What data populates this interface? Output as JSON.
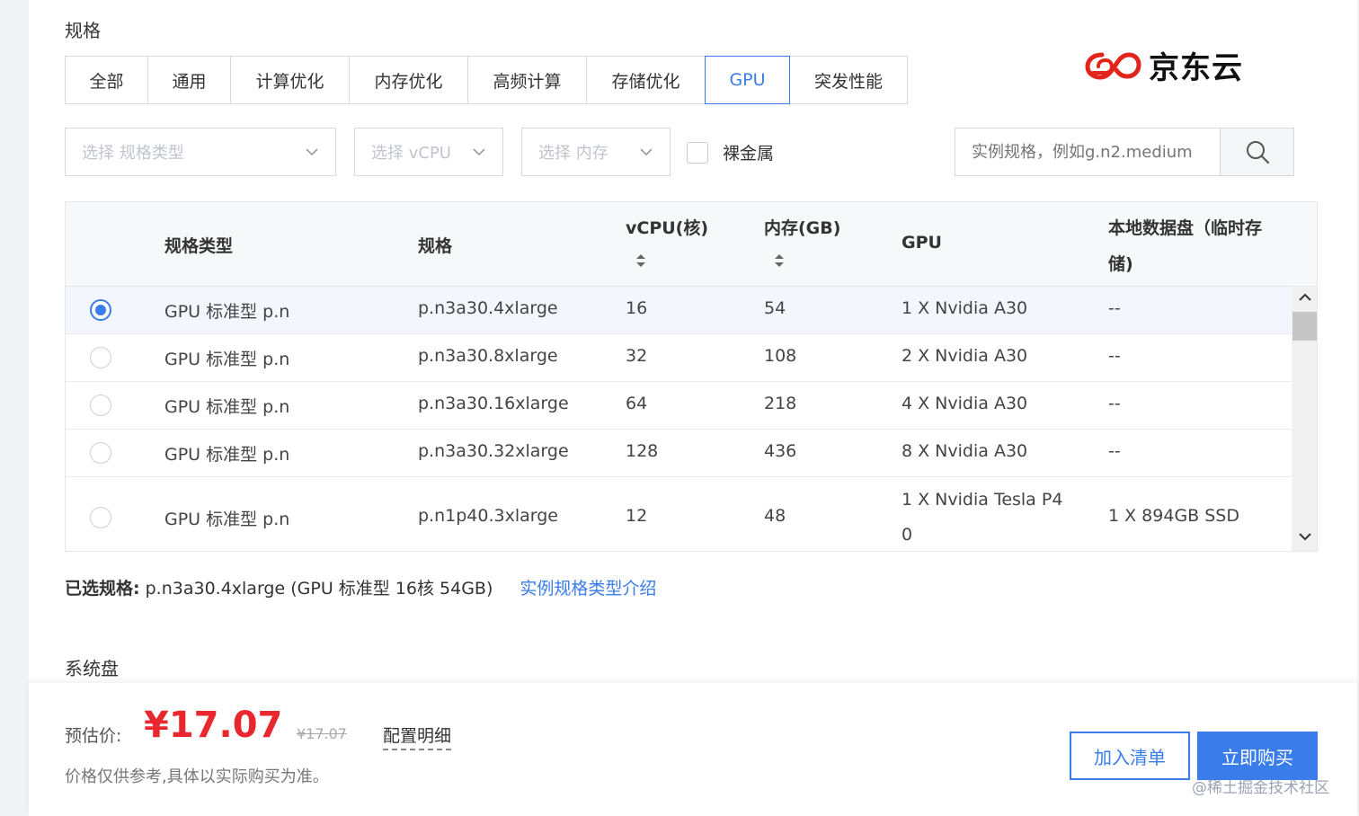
{
  "section": {
    "title": "规格"
  },
  "tabs": [
    {
      "label": "全部",
      "active": false
    },
    {
      "label": "通用",
      "active": false
    },
    {
      "label": "计算优化",
      "active": false
    },
    {
      "label": "内存优化",
      "active": false
    },
    {
      "label": "高频计算",
      "active": false
    },
    {
      "label": "存储优化",
      "active": false
    },
    {
      "label": "GPU",
      "active": true
    },
    {
      "label": "突发性能",
      "active": false
    }
  ],
  "logo": {
    "text": "京东云",
    "color": "#e1251b"
  },
  "filters": {
    "spec_type_placeholder": "选择 规格类型",
    "vcpu_placeholder": "选择 vCPU",
    "memory_placeholder": "选择 内存",
    "bare_metal_label": "裸金属",
    "search_placeholder": "实例规格，例如g.n2.medium"
  },
  "table": {
    "headers": {
      "type": "规格类型",
      "spec": "规格",
      "vcpu": "vCPU(核)",
      "memory": "内存(GB)",
      "gpu": "GPU",
      "disk_line1": "本地数据盘（临时存",
      "disk_line2": "储)"
    },
    "rows": [
      {
        "type": "GPU 标准型 p.n",
        "spec": "p.n3a30.4xlarge",
        "vcpu": "16",
        "memory": "54",
        "gpu": "1 X Nvidia A30",
        "gpu2": "",
        "disk": "--",
        "selected": true
      },
      {
        "type": "GPU 标准型 p.n",
        "spec": "p.n3a30.8xlarge",
        "vcpu": "32",
        "memory": "108",
        "gpu": "2 X Nvidia A30",
        "gpu2": "",
        "disk": "--",
        "selected": false
      },
      {
        "type": "GPU 标准型 p.n",
        "spec": "p.n3a30.16xlarge",
        "vcpu": "64",
        "memory": "218",
        "gpu": "4 X Nvidia A30",
        "gpu2": "",
        "disk": "--",
        "selected": false
      },
      {
        "type": "GPU 标准型 p.n",
        "spec": "p.n3a30.32xlarge",
        "vcpu": "128",
        "memory": "436",
        "gpu": "8 X Nvidia A30",
        "gpu2": "",
        "disk": "--",
        "selected": false
      },
      {
        "type": "GPU 标准型 p.n",
        "spec": "p.n1p40.3xlarge",
        "vcpu": "12",
        "memory": "48",
        "gpu": "1 X Nvidia Tesla P4",
        "gpu2": "0",
        "disk": "1 X 894GB SSD",
        "selected": false
      }
    ]
  },
  "selection": {
    "label": "已选规格:",
    "value": "p.n3a30.4xlarge (GPU 标准型 16核 54GB)",
    "link": "实例规格类型介绍"
  },
  "system_disk": {
    "title": "系统盘"
  },
  "footer": {
    "price_label": "预估价:",
    "price": "¥17.07",
    "old_price": "¥17.07",
    "detail_link": "配置明细",
    "note": "价格仅供参考,具体以实际购买为准。",
    "add_to_cart": "加入清单",
    "buy_now": "立即购买",
    "watermark": "@稀土掘金技术社区"
  },
  "colors": {
    "accent": "#3a7dea",
    "price": "#e8282e"
  }
}
